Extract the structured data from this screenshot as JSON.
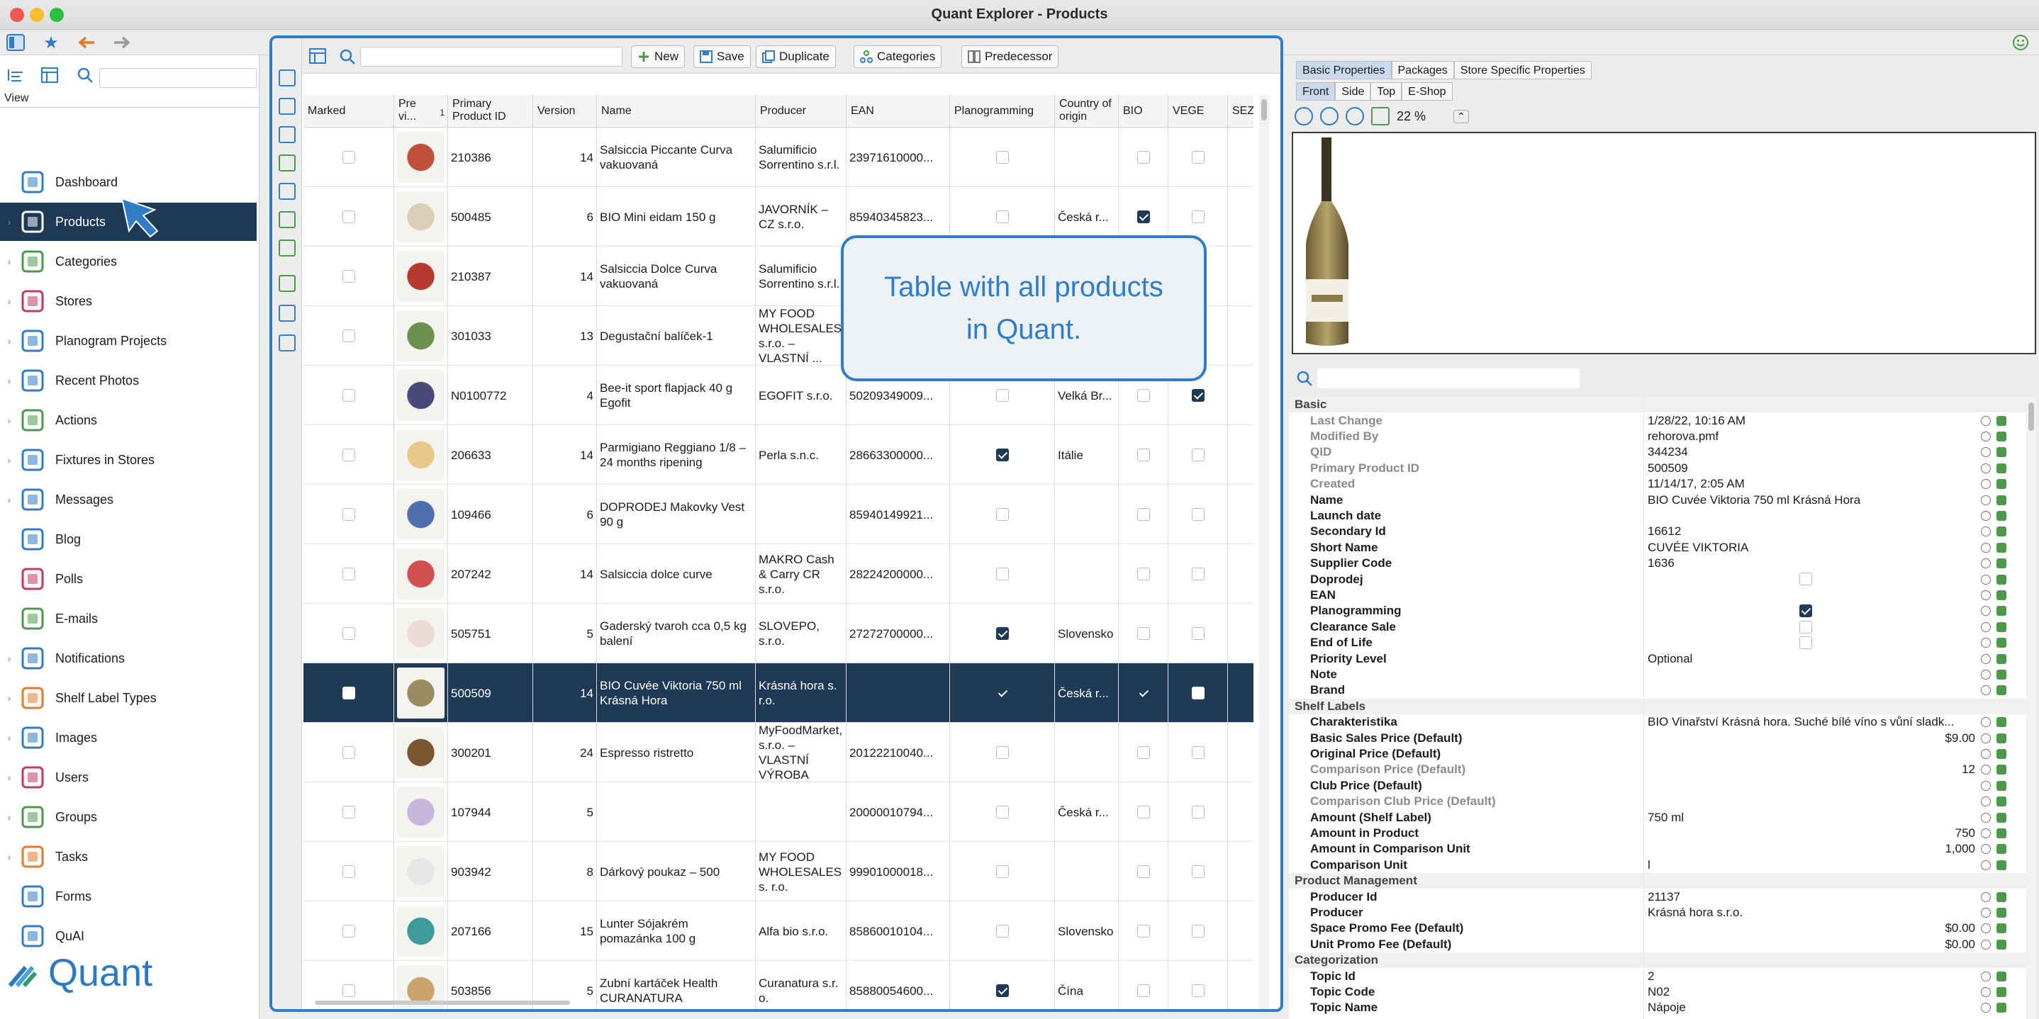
{
  "window": {
    "title": "Quant Explorer - Products"
  },
  "sidebar": {
    "view_label": "View",
    "items": [
      {
        "label": "Dashboard",
        "icon": "dashboard-icon",
        "active": false
      },
      {
        "label": "Products",
        "icon": "products-icon",
        "active": true
      },
      {
        "label": "Categories",
        "icon": "categories-icon",
        "active": false
      },
      {
        "label": "Stores",
        "icon": "stores-icon",
        "active": false
      },
      {
        "label": "Planogram Projects",
        "icon": "planogram-icon",
        "active": false
      },
      {
        "label": "Recent Photos",
        "icon": "camera-icon",
        "active": false
      },
      {
        "label": "Actions",
        "icon": "actions-icon",
        "active": false
      },
      {
        "label": "Fixtures in Stores",
        "icon": "fixtures-icon",
        "active": false
      },
      {
        "label": "Messages",
        "icon": "messages-icon",
        "active": false
      },
      {
        "label": "Blog",
        "icon": "blog-icon",
        "active": false
      },
      {
        "label": "Polls",
        "icon": "polls-icon",
        "active": false
      },
      {
        "label": "E-mails",
        "icon": "email-icon",
        "active": false
      },
      {
        "label": "Notifications",
        "icon": "notifications-icon",
        "active": false
      },
      {
        "label": "Shelf Label Types",
        "icon": "shelf-label-icon",
        "active": false
      },
      {
        "label": "Images",
        "icon": "images-icon",
        "active": false
      },
      {
        "label": "Users",
        "icon": "users-icon",
        "active": false
      },
      {
        "label": "Groups",
        "icon": "groups-icon",
        "active": false
      },
      {
        "label": "Tasks",
        "icon": "tasks-icon",
        "active": false
      },
      {
        "label": "Forms",
        "icon": "forms-icon",
        "active": false
      },
      {
        "label": "QuAI",
        "icon": "quai-icon",
        "active": false
      }
    ],
    "logo_text": "Quant"
  },
  "toolbar": {
    "new_label": "New",
    "save_label": "Save",
    "duplicate_label": "Duplicate",
    "categories_label": "Categories",
    "predecessor_label": "Predecessor"
  },
  "table": {
    "headers": {
      "marked": "Marked",
      "preview_line1": "Pre",
      "preview_line2": "vi...",
      "sort_index": "1",
      "ppid_line1": "Primary",
      "ppid_line2": "Product ID",
      "version": "Version",
      "name": "Name",
      "producer": "Producer",
      "ean": "EAN",
      "planogramming": "Planogramming",
      "country_line1": "Country of",
      "country_line2": "origin",
      "bio": "BIO",
      "vege": "VEGE",
      "sezon": "SEZÓN"
    },
    "rows": [
      {
        "marked": false,
        "ppid": "210386",
        "version": "14",
        "name": "Salsiccia Piccante Curva vakuovaná",
        "producer": "Salumificio Sorrentino s.r.l.",
        "ean": "23971610000...",
        "planogramming": false,
        "country": "",
        "bio": false,
        "vege": false,
        "selected": false,
        "thumb": "#c0503a"
      },
      {
        "marked": false,
        "ppid": "500485",
        "version": "6",
        "name": "BIO Mini eidam 150 g",
        "producer": "JAVORNÍK – CZ s.r.o.",
        "ean": "85940345823...",
        "planogramming": false,
        "country": "Česká r...",
        "bio": true,
        "vege": false,
        "selected": false,
        "thumb": "#d9cfb8"
      },
      {
        "marked": false,
        "ppid": "210387",
        "version": "14",
        "name": "Salsiccia Dolce Curva vakuovaná",
        "producer": "Salumificio Sorrentino s.r.l.",
        "ean": "",
        "planogramming": false,
        "country": "",
        "bio": false,
        "vege": false,
        "selected": false,
        "thumb": "#b8392e"
      },
      {
        "marked": false,
        "ppid": "301033",
        "version": "13",
        "name": "Degustační balíček-1",
        "producer": "MY FOOD WHOLESALES, s.r.o. – VLASTNÍ ...",
        "ean": "",
        "planogramming": false,
        "country": "",
        "bio": false,
        "vege": false,
        "selected": false,
        "thumb": "#6b8f4e"
      },
      {
        "marked": false,
        "ppid": "N0100772",
        "version": "4",
        "name": "Bee-it sport flapjack 40 g Egofit",
        "producer": "EGOFIT s.r.o.",
        "ean": "50209349009...",
        "planogramming": false,
        "country": "Velká Br...",
        "bio": false,
        "vege": true,
        "selected": false,
        "thumb": "#4a4a7a"
      },
      {
        "marked": false,
        "ppid": "206633",
        "version": "14",
        "name": "Parmigiano Reggiano 1/8 – 24 months ripening",
        "producer": "Perla s.n.c.",
        "ean": "28663300000...",
        "planogramming": true,
        "country": "Itálie",
        "bio": false,
        "vege": false,
        "selected": false,
        "thumb": "#e8c98a"
      },
      {
        "marked": false,
        "ppid": "109466",
        "version": "6",
        "name": "DOPRODEJ Makovky Vest 90 g",
        "producer": "",
        "ean": "85940149921...",
        "planogramming": false,
        "country": "",
        "bio": false,
        "vege": false,
        "selected": false,
        "thumb": "#4f6fb0"
      },
      {
        "marked": false,
        "ppid": "207242",
        "version": "14",
        "name": "Salsiccia dolce curve",
        "producer": "MAKRO Cash & Carry CR s.r.o.",
        "ean": "28224200000...",
        "planogramming": false,
        "country": "",
        "bio": false,
        "vege": false,
        "selected": false,
        "thumb": "#d05050"
      },
      {
        "marked": false,
        "ppid": "505751",
        "version": "5",
        "name": "Gaderský tvaroh cca 0,5 kg balení",
        "producer": "SLOVEPO, s.r.o.",
        "ean": "27272700000...",
        "planogramming": true,
        "country": "Slovensko",
        "bio": false,
        "vege": false,
        "selected": false,
        "thumb": "#eadbd4"
      },
      {
        "marked": false,
        "ppid": "500509",
        "version": "14",
        "name": "BIO Cuvée Viktoria 750 ml Krásná Hora",
        "producer": "Krásná hora s. r.o.",
        "ean": "",
        "planogramming": true,
        "country": "Česká r...",
        "bio": true,
        "vege": false,
        "selected": true,
        "thumb": "#9a8b62"
      },
      {
        "marked": false,
        "ppid": "300201",
        "version": "24",
        "name": "Espresso ristretto",
        "producer": "MyFoodMarket, s.r.o. – VLASTNÍ VÝROBA",
        "ean": "20122210040...",
        "planogramming": false,
        "country": "",
        "bio": false,
        "vege": false,
        "selected": false,
        "thumb": "#7a5530"
      },
      {
        "marked": false,
        "ppid": "107944",
        "version": "5",
        "name": "",
        "producer": "",
        "ean": "20000010794...",
        "planogramming": false,
        "country": "Česká r...",
        "bio": false,
        "vege": false,
        "selected": false,
        "thumb": "#c7b6d9"
      },
      {
        "marked": false,
        "ppid": "903942",
        "version": "8",
        "name": "Dárkový poukaz – 500",
        "producer": "MY FOOD WHOLESALES s. r.o.",
        "ean": "99901000018...",
        "planogramming": false,
        "country": "",
        "bio": false,
        "vege": false,
        "selected": false,
        "thumb": "#e6e6e6"
      },
      {
        "marked": false,
        "ppid": "207166",
        "version": "15",
        "name": "Lunter Sójakrém pomazánka 100 g",
        "producer": "Alfa bio s.r.o.",
        "ean": "85860010104...",
        "planogramming": false,
        "country": "Slovensko",
        "bio": false,
        "vege": false,
        "selected": false,
        "thumb": "#3f9a9a"
      },
      {
        "marked": false,
        "ppid": "503856",
        "version": "5",
        "name": "Zubní kartáček Health CURANATURA",
        "producer": "Curanatura s.r. o.",
        "ean": "85880054600...",
        "planogramming": true,
        "country": "Čína",
        "bio": false,
        "vege": false,
        "selected": false,
        "thumb": "#c9a46a"
      }
    ]
  },
  "callout": {
    "text": "Table with all products in Quant."
  },
  "right_panel": {
    "tabs": [
      "Basic Properties",
      "Packages",
      "Store Specific Properties"
    ],
    "view_tabs": [
      "Front",
      "Side",
      "Top",
      "E-Shop"
    ],
    "zoom_value": "22 %",
    "properties": [
      {
        "type": "section",
        "label": "Basic"
      },
      {
        "label": "Last Change",
        "value": "1/28/22, 10:16 AM",
        "grey": true
      },
      {
        "label": "Modified By",
        "value": "rehorova.pmf",
        "grey": true
      },
      {
        "label": "QID",
        "value": "344234",
        "grey": true
      },
      {
        "label": "Primary Product ID",
        "value": "500509",
        "grey": true
      },
      {
        "label": "Created",
        "value": "11/14/17, 2:05 AM",
        "grey": true
      },
      {
        "label": "Name",
        "value": "BIO Cuvée Viktoria 750 ml Krásná Hora"
      },
      {
        "label": "Launch date",
        "value": ""
      },
      {
        "label": "Secondary Id",
        "value": "16612"
      },
      {
        "label": "Short Name",
        "value": "CUVÉE VIKTORIA"
      },
      {
        "label": "Supplier Code",
        "value": "1636"
      },
      {
        "label": "Doprodej",
        "checkbox": false
      },
      {
        "label": "EAN",
        "value": ""
      },
      {
        "label": "Planogramming",
        "checkbox": true
      },
      {
        "label": "Clearance Sale",
        "checkbox": false
      },
      {
        "label": "End of Life",
        "checkbox": false
      },
      {
        "label": "Priority Level",
        "value": "Optional"
      },
      {
        "label": "Note",
        "value": ""
      },
      {
        "label": "Brand",
        "value": ""
      },
      {
        "type": "section",
        "label": "Shelf Labels"
      },
      {
        "label": "Charakteristika",
        "value": "BIO Vinařství Krásná hora. Suché bílé víno s vůní sladk..."
      },
      {
        "label": "Basic Sales Price (Default)",
        "value": "$9.00",
        "right": true
      },
      {
        "label": "Original Price (Default)",
        "value": ""
      },
      {
        "label": "Comparison Price (Default)",
        "value": "12",
        "right": true,
        "grey": true
      },
      {
        "label": "Club Price (Default)",
        "value": ""
      },
      {
        "label": "Comparison Club Price (Default)",
        "value": "",
        "grey": true
      },
      {
        "label": "Amount (Shelf Label)",
        "value": "750 ml"
      },
      {
        "label": "Amount in Product",
        "value": "750",
        "right": true
      },
      {
        "label": "Amount in Comparison Unit",
        "value": "1,000",
        "right": true
      },
      {
        "label": "Comparison Unit",
        "value": "l"
      },
      {
        "type": "section",
        "label": "Product Management"
      },
      {
        "label": "Producer Id",
        "value": "21137"
      },
      {
        "label": "Producer",
        "value": "Krásná hora s.r.o."
      },
      {
        "label": "Space Promo Fee (Default)",
        "value": "$0.00",
        "right": true
      },
      {
        "label": "Unit Promo Fee (Default)",
        "value": "$0.00",
        "right": true
      },
      {
        "type": "section",
        "label": "Categorization"
      },
      {
        "label": "Topic Id",
        "value": "2"
      },
      {
        "label": "Topic Code",
        "value": "N02"
      },
      {
        "label": "Topic Name",
        "value": "Nápoje"
      }
    ]
  }
}
